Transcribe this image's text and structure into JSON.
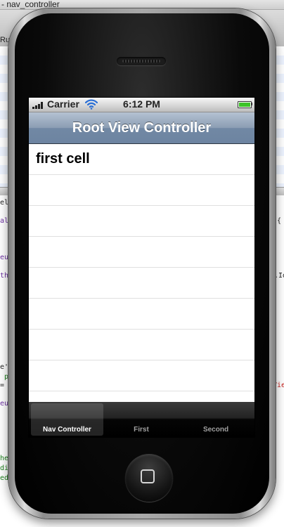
{
  "background_window": {
    "title_fragment": "- nav_controller",
    "toolbar_fragment_left": "Ru",
    "toolbar_fragment_right": "C",
    "code_fragments": [
      {
        "text": "ele",
        "color": "#222222"
      },
      {
        "text": "{",
        "color": "#222222"
      },
      {
        "text": "al",
        "color": "#6b2fa0"
      },
      {
        "text": "eu",
        "color": "#6b2fa0"
      },
      {
        "text": "th",
        "color": "#6b2fa0"
      },
      {
        "text": ".Id",
        "color": "#222222"
      },
      {
        "text": "e'",
        "color": "#222222"
      },
      {
        "text": "p",
        "color": "#1b7f1b"
      },
      {
        "text": "=",
        "color": "#222222"
      },
      {
        "text": "Vie",
        "color": "#c41a16"
      },
      {
        "text": "eu",
        "color": "#6b2fa0"
      },
      {
        "text": "he",
        "color": "#1b7f1b"
      },
      {
        "text": "di",
        "color": "#1b7f1b"
      },
      {
        "text": "ed",
        "color": "#1b7f1b"
      }
    ]
  },
  "status_bar": {
    "carrier": "Carrier",
    "time": "6:12 PM",
    "battery_color": "#3cc428"
  },
  "nav_bar": {
    "title": "Root View Controller"
  },
  "table": {
    "rows": [
      "first cell",
      "",
      "",
      "",
      "",
      "",
      "",
      ""
    ]
  },
  "tab_bar": {
    "items": [
      {
        "label": "Nav Controller",
        "selected": true
      },
      {
        "label": "First",
        "selected": false
      },
      {
        "label": "Second",
        "selected": false
      }
    ]
  }
}
